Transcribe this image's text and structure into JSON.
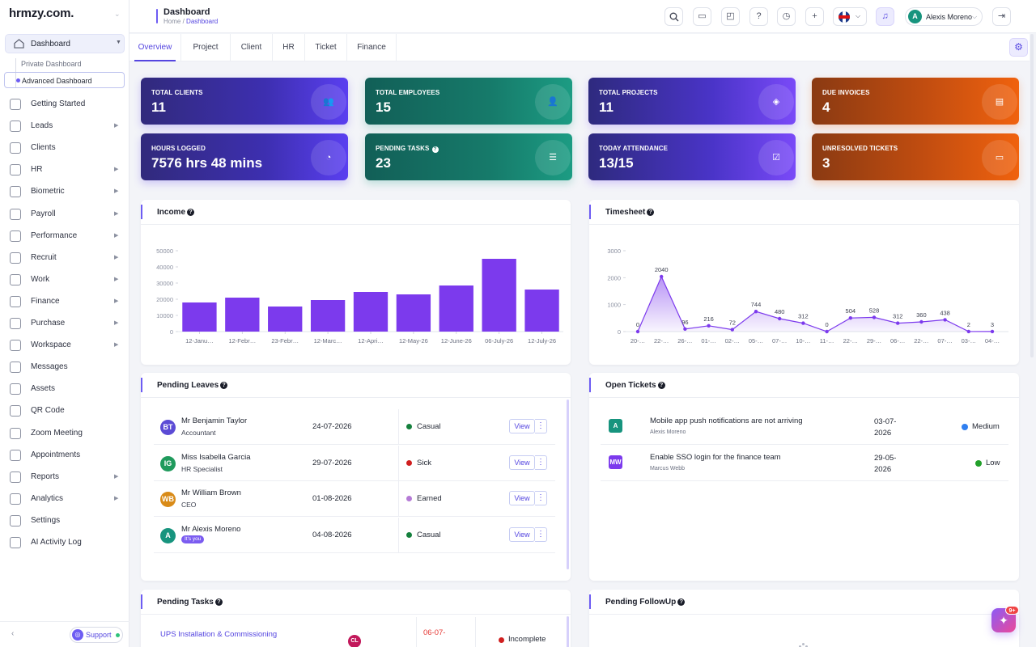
{
  "brand": {
    "logo": "hrmzy.com."
  },
  "sidebar": {
    "dashboard": "Dashboard",
    "sub_items": [
      "Private Dashboard",
      "Advanced Dashboard"
    ],
    "items": [
      {
        "label": "Getting Started",
        "arrow": false
      },
      {
        "label": "Leads",
        "arrow": true
      },
      {
        "label": "Clients",
        "arrow": false
      },
      {
        "label": "HR",
        "arrow": true
      },
      {
        "label": "Biometric",
        "arrow": true
      },
      {
        "label": "Payroll",
        "arrow": true
      },
      {
        "label": "Performance",
        "arrow": true
      },
      {
        "label": "Recruit",
        "arrow": true
      },
      {
        "label": "Work",
        "arrow": true
      },
      {
        "label": "Finance",
        "arrow": true
      },
      {
        "label": "Purchase",
        "arrow": true
      },
      {
        "label": "Workspace",
        "arrow": true
      },
      {
        "label": "Messages",
        "arrow": false
      },
      {
        "label": "Assets",
        "arrow": false
      },
      {
        "label": "QR Code",
        "arrow": false
      },
      {
        "label": "Zoom Meeting",
        "arrow": false
      },
      {
        "label": "Appointments",
        "arrow": false
      },
      {
        "label": "Reports",
        "arrow": true
      },
      {
        "label": "Analytics",
        "arrow": true
      },
      {
        "label": "Settings",
        "arrow": false
      },
      {
        "label": "AI Activity Log",
        "arrow": false
      }
    ],
    "support": "Support"
  },
  "header": {
    "title": "Dashboard",
    "crumb_home": "Home",
    "crumb_sep": "/",
    "crumb_current": "Dashboard",
    "user_initial": "A",
    "user_name": "Alexis Moreno",
    "notif_count": "6"
  },
  "tabs": [
    "Overview",
    "Project",
    "Client",
    "HR",
    "Ticket",
    "Finance"
  ],
  "kpis": [
    {
      "label": "TOTAL CLIENTS",
      "value": "11",
      "icon": "users-icon",
      "style": "purple"
    },
    {
      "label": "TOTAL EMPLOYEES",
      "value": "15",
      "icon": "user-icon",
      "style": "teal"
    },
    {
      "label": "TOTAL PROJECTS",
      "value": "11",
      "icon": "layers-icon",
      "style": "violet"
    },
    {
      "label": "DUE INVOICES",
      "value": "4",
      "icon": "invoice-icon",
      "style": "orange"
    },
    {
      "label": "HOURS LOGGED",
      "value": "7576 hrs 48 mins",
      "icon": "clock-icon",
      "style": "purple"
    },
    {
      "label": "PENDING TASKS",
      "value": "23",
      "icon": "tasks-icon",
      "style": "teal",
      "help": true
    },
    {
      "label": "TODAY ATTENDANCE",
      "value": "13/15",
      "icon": "calendar-check-icon",
      "style": "violet"
    },
    {
      "label": "UNRESOLVED TICKETS",
      "value": "3",
      "icon": "ticket-icon",
      "style": "orange"
    }
  ],
  "panels": {
    "income": "Income",
    "timesheet": "Timesheet",
    "pending_leaves": "Pending Leaves",
    "open_tickets": "Open Tickets",
    "pending_tasks": "Pending Tasks",
    "pending_followup": "Pending FollowUp",
    "help": "?"
  },
  "chart_data": [
    {
      "type": "bar",
      "categories": [
        "12-Janu…",
        "12-Febr…",
        "23-Febr…",
        "12-Marc…",
        "12-Apri…",
        "12-May-26",
        "12-June-26",
        "06-July-26",
        "12-July-26"
      ],
      "values": [
        18000,
        21000,
        15500,
        19500,
        24500,
        23000,
        28500,
        45000,
        26000
      ],
      "ylim": [
        0,
        50000
      ],
      "yticks": [
        0,
        10000,
        20000,
        30000,
        40000,
        50000
      ],
      "color": "#7c3aed"
    },
    {
      "type": "area",
      "categories": [
        "20-…",
        "22-…",
        "26-…",
        "01-…",
        "02-…",
        "05-…",
        "07-…",
        "10-…",
        "11-…",
        "22-…",
        "29-…",
        "06-…",
        "22-…",
        "07-…",
        "03-…",
        "04-…"
      ],
      "values": [
        0,
        2040,
        96,
        216,
        72,
        744,
        480,
        312,
        0,
        504,
        528,
        312,
        360,
        438,
        2,
        3
      ],
      "ylim": [
        0,
        3000
      ],
      "yticks": [
        0,
        1000,
        2000,
        3000
      ],
      "color": "#7c3aed"
    }
  ],
  "leaves": [
    {
      "initials": "BT",
      "name": "Mr Benjamin Taylor",
      "role": "Accountant",
      "date": "24-07-2026",
      "type": "Casual",
      "dot": "#15803d",
      "avatar": "#5b4bd5",
      "me": false
    },
    {
      "initials": "IG",
      "name": "Miss Isabella Garcia",
      "role": "HR Specialist",
      "date": "29-07-2026",
      "type": "Sick",
      "dot": "#d01f1f",
      "avatar": "#1f9a5c",
      "me": false
    },
    {
      "initials": "WB",
      "name": "Mr William Brown",
      "role": "CEO",
      "date": "01-08-2026",
      "type": "Earned",
      "dot": "#b57bd6",
      "avatar": "#d98b18",
      "me": false
    },
    {
      "initials": "A",
      "name": "Mr Alexis Moreno",
      "role": "It's you",
      "date": "04-08-2026",
      "type": "Casual",
      "dot": "#15803d",
      "avatar": "#17947e",
      "me": true
    }
  ],
  "leave_actions": {
    "view": "View",
    "more": "⋮"
  },
  "tickets": [
    {
      "initials": "A",
      "subject": "Mobile app push notifications are not arriving",
      "by": "Alexis Moreno",
      "date": "03-07-2026",
      "priority": "Medium",
      "dot": "#2f7ff0",
      "avatar": "#17947e"
    },
    {
      "initials": "MW",
      "subject": "Enable SSO login for the finance team",
      "by": "Marcus Webb",
      "date": "29-05-2026",
      "priority": "Low",
      "dot": "#22a02a",
      "avatar": "#7c3aed"
    }
  ],
  "task_preview": {
    "title": "UPS Installation & Commissioning",
    "initials": "CL",
    "date": "06-07-",
    "status": "Incomplete"
  },
  "fab": {
    "badge": "9+"
  }
}
